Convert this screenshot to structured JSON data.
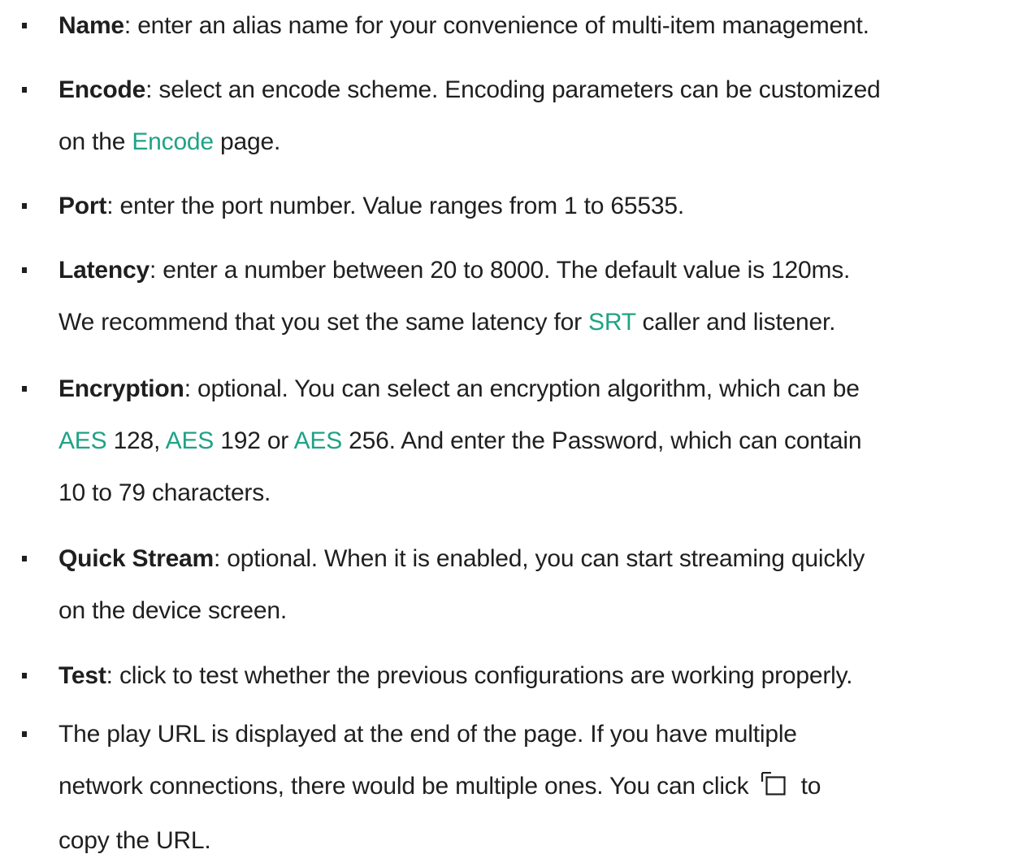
{
  "items": [
    {
      "term": "Name",
      "line1": ": enter an alias name for your convenience of multi-item management."
    },
    {
      "term": "Encode",
      "line1": ": select an encode scheme. Encoding parameters can be customized",
      "line2_pre": "on the ",
      "line2_link": "Encode",
      "line2_post": " page."
    },
    {
      "term": "Port",
      "line1": ": enter the port number. Value ranges from 1 to 65535."
    },
    {
      "term": "Latency",
      "line1": ": enter a number between 20 to 8000. The default value is 120ms.",
      "line2_pre": "We recommend that you set the same latency for ",
      "line2_link": "SRT",
      "line2_post": " caller and listener."
    },
    {
      "term": "Encryption",
      "line1": ": optional. You can select an encryption algorithm, which can be",
      "line2_link1": "AES",
      "line2_mid1": " 128, ",
      "line2_link2": "AES",
      "line2_mid2": " 192 or ",
      "line2_link3": "AES",
      "line2_post": " 256. And enter the Password, which can contain",
      "line3": "10 to 79 characters."
    },
    {
      "term": "Quick Stream",
      "line1": ": optional. When it is enabled, you can start streaming quickly",
      "line2": "on the device screen."
    },
    {
      "term": "Test",
      "line1": ": click to test whether the previous configurations are working properly."
    },
    {
      "line1": "The play URL is displayed at the end of the page. If you have multiple",
      "line2_pre": "network connections, there would be multiple ones. You can click ",
      "line2_icon": "copy-icon",
      "line2_post": " to",
      "line3": "copy the URL."
    }
  ]
}
